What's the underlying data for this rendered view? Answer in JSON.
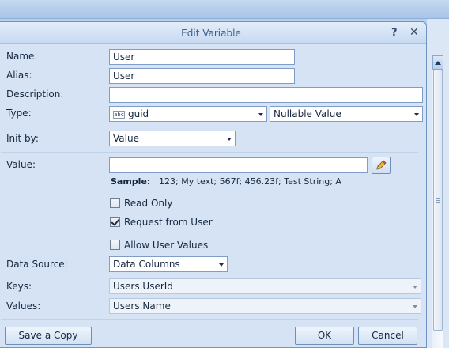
{
  "dialog": {
    "title": "Edit Variable",
    "help_label": "?",
    "close_label": "✕"
  },
  "form": {
    "name_label": "Name:",
    "name_value": "User",
    "alias_label": "Alias:",
    "alias_value": "User",
    "description_label": "Description:",
    "description_value": "",
    "type_label": "Type:",
    "type_icon_text": "abc",
    "type_value": "guid",
    "type_kind_value": "Nullable Value",
    "init_by_label": "Init by:",
    "init_by_value": "Value",
    "value_label": "Value:",
    "value_value": "",
    "sample_label": "Sample:",
    "sample_text": "123; My text; 567f; 456.23f; Test String; A",
    "read_only_label": "Read Only",
    "read_only_checked": false,
    "request_from_user_label": "Request from User",
    "request_from_user_checked": true,
    "allow_user_values_label": "Allow User Values",
    "allow_user_values_checked": false,
    "data_source_label": "Data Source:",
    "data_source_value": "Data Columns",
    "keys_label": "Keys:",
    "keys_value": "Users.UserId",
    "values_label": "Values:",
    "values_value": "Users.Name"
  },
  "footer": {
    "save_copy_label": "Save a Copy",
    "ok_label": "OK",
    "cancel_label": "Cancel"
  },
  "icons": {
    "edit_value": "pencil-icon",
    "type": "text-type-icon"
  },
  "colors": {
    "dialog_bg": "#d5e3f5",
    "title_text": "#3b5f8f",
    "field_border": "#7f9dc6"
  }
}
